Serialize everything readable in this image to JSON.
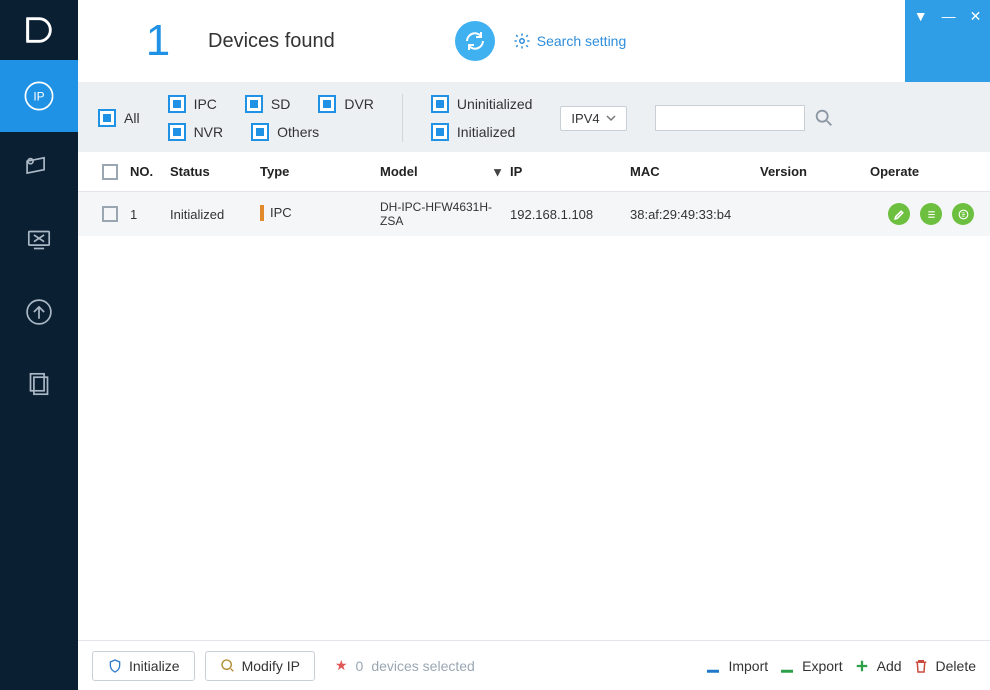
{
  "window_controls": {
    "collapse": "▼",
    "minimize": "—",
    "close": "✕"
  },
  "header": {
    "count": "1",
    "title": "Devices found",
    "search_setting": "Search setting"
  },
  "filters": {
    "all": "All",
    "ipc": "IPC",
    "sd": "SD",
    "dvr": "DVR",
    "nvr": "NVR",
    "others": "Others",
    "uninitialized": "Uninitialized",
    "initialized": "Initialized",
    "ipver_selected": "IPV4",
    "search_placeholder": ""
  },
  "table": {
    "headers": {
      "no": "NO.",
      "status": "Status",
      "type": "Type",
      "model": "Model",
      "ip": "IP",
      "mac": "MAC",
      "version": "Version",
      "operate": "Operate"
    },
    "rows": [
      {
        "no": "1",
        "status": "Initialized",
        "type": "IPC",
        "model": "DH-IPC-HFW4631H-ZSA",
        "ip": "192.168.1.108",
        "mac": "38:af:29:49:33:b4",
        "version": ""
      }
    ]
  },
  "footer": {
    "initialize": "Initialize",
    "modify_ip": "Modify IP",
    "selected_count": "0",
    "selected_label": "devices selected",
    "import": "Import",
    "export": "Export",
    "add": "Add",
    "delete": "Delete"
  }
}
